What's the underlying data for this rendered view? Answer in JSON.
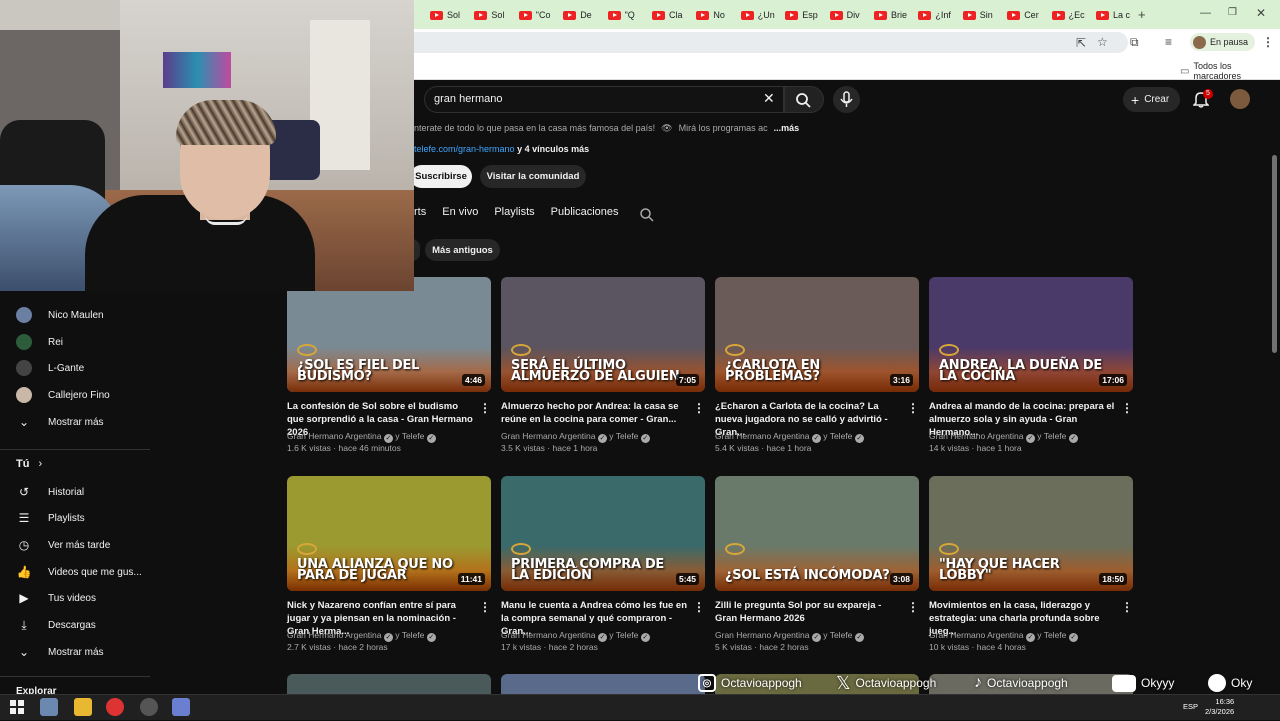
{
  "browser": {
    "tabs": [
      {
        "label": "Sol"
      },
      {
        "label": "Sol"
      },
      {
        "label": "\"Co"
      },
      {
        "label": "De"
      },
      {
        "label": "\"Q"
      },
      {
        "label": "Cla"
      },
      {
        "label": "No"
      },
      {
        "label": "¿Un"
      },
      {
        "label": "Esp"
      },
      {
        "label": "Div"
      },
      {
        "label": "Brie"
      },
      {
        "label": "¿Inf"
      },
      {
        "label": "Sin"
      },
      {
        "label": "Cer"
      },
      {
        "label": "¿Ec"
      },
      {
        "label": "La c"
      }
    ],
    "new_tab": "+",
    "profile_status": "En pausa",
    "bookmarks_label": "Todos los marcadores"
  },
  "header": {
    "search_value": "gran hermano",
    "create_label": "Crear",
    "notif_count": "5"
  },
  "channel": {
    "description": "nterate de todo lo que pasa en la casa más famosa del país!",
    "description2": "Mirá los programas ac",
    "more_label": "...más",
    "link": "telefe.com/gran-hermano",
    "links_more": "y 4 vínculos más",
    "subscribe_label": "Suscribirse",
    "community_label": "Visitar la comunidad",
    "tabs": [
      "rts",
      "En vivo",
      "Playlists",
      "Publicaciones"
    ],
    "sort_label": "Más antiguos"
  },
  "sidebar": {
    "subscriptions": [
      {
        "label": "Nico Maulen",
        "color": "#6b7fa3"
      },
      {
        "label": "Rei",
        "color": "#2d5c3a"
      },
      {
        "label": "L-Gante",
        "color": "#444444"
      },
      {
        "label": "Callejero Fino",
        "color": "#c9b8a8"
      }
    ],
    "show_more": "Mostrar más",
    "you_header": "Tú",
    "you_items": [
      {
        "label": "Historial",
        "icon": "history-icon"
      },
      {
        "label": "Playlists",
        "icon": "playlists-icon"
      },
      {
        "label": "Ver más tarde",
        "icon": "watch-later-icon"
      },
      {
        "label": "Videos que me gus...",
        "icon": "like-icon"
      },
      {
        "label": "Tus videos",
        "icon": "your-videos-icon"
      },
      {
        "label": "Descargas",
        "icon": "download-icon"
      }
    ],
    "show_more2": "Mostrar más",
    "explore_header": "Explorar"
  },
  "videos": [
    {
      "thumb_text": "¿Sol es fiel del budismo?",
      "duration": "4:46",
      "title": "La confesión de Sol sobre el budismo que sorprendió a la casa - Gran Hermano 2026",
      "channel": "Gran Hermano Argentina",
      "collab": "y Telefe",
      "views": "1.6 K vistas",
      "age": "hace 46 minutos",
      "bg": "#7a8a94"
    },
    {
      "thumb_text": "Será el último almuerzo de alguien",
      "duration": "7:05",
      "title": "Almuerzo hecho por Andrea: la casa se reúne en la cocina para comer - Gran...",
      "channel": "Gran Hermano Argentina",
      "collab": "y Telefe",
      "views": "3.5 K vistas",
      "age": "hace 1 hora",
      "bg": "#5a5560"
    },
    {
      "thumb_text": "¿Carlota en problemas?",
      "duration": "3:16",
      "title": "¿Echaron a Carlota de la cocina? La nueva jugadora no se calló y advirtió - Gran...",
      "channel": "Gran Hermano Argentina",
      "collab": "y Telefe",
      "views": "5.4 K vistas",
      "age": "hace 1 hora",
      "bg": "#6a5a58"
    },
    {
      "thumb_text": "Andrea, la dueña de la cocina",
      "duration": "17:06",
      "title": "Andrea al mando de la cocina: prepara el almuerzo sola y sin ayuda - Gran Hermano...",
      "channel": "Gran Hermano Argentina",
      "collab": "y Telefe",
      "views": "14 k vistas",
      "age": "hace 1 hora",
      "bg": "#4a3a6a"
    },
    {
      "thumb_text": "Una alianza que no para de jugar",
      "duration": "11:41",
      "title": "Nick y Nazareno confían entre sí para jugar y ya piensan en la nominación - Gran Herma...",
      "channel": "Gran Hermano Argentina",
      "collab": "y Telefe",
      "views": "2.7 K vistas",
      "age": "hace 2 horas",
      "bg": "#9a9a30"
    },
    {
      "thumb_text": "Primera compra de la edición",
      "duration": "5:45",
      "title": "Manu le cuenta a Andrea cómo les fue en la compra semanal y qué compraron - Gran...",
      "channel": "Gran Hermano Argentina",
      "collab": "y Telefe",
      "views": "17 k vistas",
      "age": "hace 2 horas",
      "bg": "#3a6a6a"
    },
    {
      "thumb_text": "¿Sol está incómoda?",
      "duration": "3:08",
      "title": "Zilli le pregunta Sol por su expareja - Gran Hermano 2026",
      "channel": "Gran Hermano Argentina",
      "collab": "y Telefe",
      "views": "5 K vistas",
      "age": "hace 2 horas",
      "bg": "#6a7a6a"
    },
    {
      "thumb_text": "\"Hay que hacer lobby\"",
      "duration": "18:50",
      "title": "Movimientos en la casa, liderazgo y estrategia: una charla profunda sobre jueg...",
      "channel": "Gran Hermano Argentina",
      "collab": "y Telefe",
      "views": "10 k vistas",
      "age": "hace 4 horas",
      "bg": "#6a6e5a"
    }
  ],
  "stream_overlay": {
    "instagram": "Octavioappogh",
    "x": "Octavioappogh",
    "tiktok": "Octavioappogh",
    "youtube": "Okyyy",
    "spotify": "Oky"
  },
  "taskbar": {
    "lang": "ESP",
    "time": "16:36",
    "date": "2/3/2026"
  }
}
